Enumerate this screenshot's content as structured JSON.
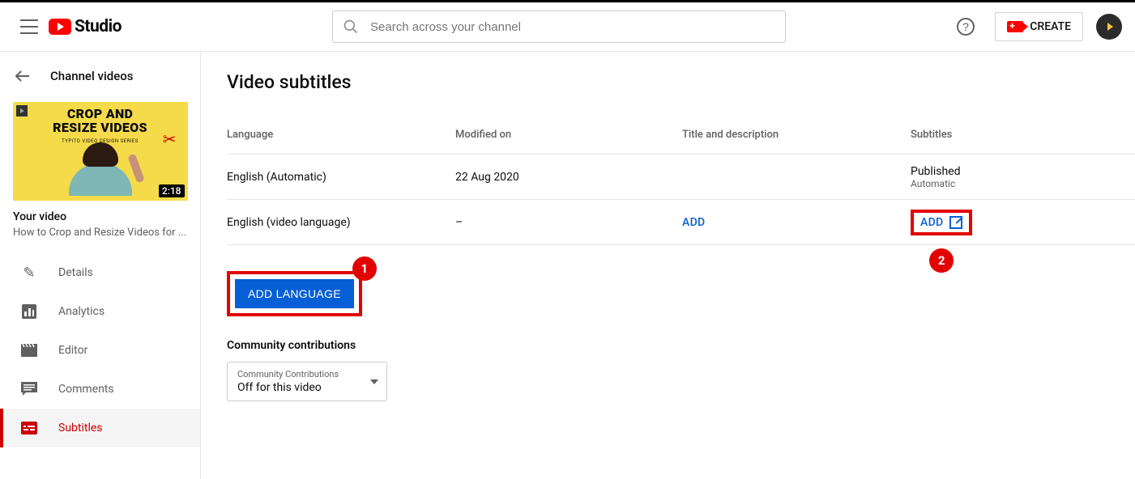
{
  "header": {
    "brand": "Studio",
    "search_placeholder": "Search across your channel",
    "create_label": "CREATE"
  },
  "sidebar": {
    "back_label": "Channel videos",
    "thumb": {
      "line1": "CROP AND",
      "line2": "RESIZE VIDEOS",
      "subline": "TYPITO VIDEO DESIGN SERIES",
      "duration": "2:18"
    },
    "your_video_label": "Your video",
    "video_title": "How to Crop and Resize Videos for ...",
    "nav": {
      "details": "Details",
      "analytics": "Analytics",
      "editor": "Editor",
      "comments": "Comments",
      "subtitles": "Subtitles"
    }
  },
  "page": {
    "title": "Video subtitles",
    "columns": {
      "language": "Language",
      "modified": "Modified on",
      "titledesc": "Title and description",
      "subtitles": "Subtitles"
    },
    "rows": [
      {
        "language": "English (Automatic)",
        "modified": "22 Aug 2020",
        "titledesc": "",
        "sub_status": "Published",
        "sub_note": "Automatic"
      },
      {
        "language": "English (video language)",
        "modified": "–",
        "titledesc_action": "ADD",
        "sub_action": "ADD"
      }
    ],
    "add_language_label": "ADD LANGUAGE",
    "community": {
      "section_label": "Community contributions",
      "field_label": "Community Contributions",
      "value": "Off for this video"
    },
    "callouts": {
      "one": "1",
      "two": "2"
    }
  }
}
